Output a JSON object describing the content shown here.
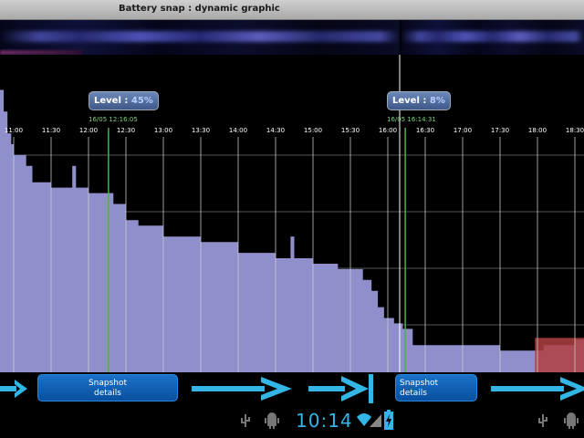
{
  "window": {
    "title": "Battery snap : dynamic graphic"
  },
  "markers": [
    {
      "label": "Level : ",
      "value": "45%",
      "timestamp": "16/05 12:16:05"
    },
    {
      "label": "Level : ",
      "value": "8%",
      "timestamp": "16/05 16:14:31"
    }
  ],
  "buttons": {
    "snapshot_line1": "Snapshot",
    "snapshot_line2": "details"
  },
  "status_bar": {
    "time": "10:14"
  },
  "colors": {
    "fill": "#8f8fcc",
    "accent": "#33b5e5",
    "button": "#0e5aa8",
    "marker_line": "#4caf50",
    "low_fill": "#b04040"
  },
  "chart_data": {
    "type": "area",
    "time_ticks": [
      "11:00",
      "11:30",
      "12:00",
      "12:30",
      "13:00",
      "13:30",
      "14:00",
      "14:30",
      "15:00",
      "15:30",
      "16:00",
      "16:30",
      "17:00",
      "17:30",
      "18:00",
      "18:30"
    ],
    "ylim": [
      0,
      100
    ],
    "series": [
      {
        "x": [
          "10:50",
          "10:52",
          "10:55",
          "10:58",
          "11:00",
          "11:10",
          "11:15",
          "11:30",
          "11:45",
          "11:47",
          "11:50",
          "12:00",
          "12:16",
          "12:20",
          "12:30",
          "12:40",
          "13:00",
          "13:30",
          "14:00",
          "14:30",
          "14:40",
          "14:42",
          "14:45",
          "15:00",
          "15:20",
          "15:30",
          "15:40",
          "15:47",
          "15:52",
          "15:57",
          "16:00",
          "16:05",
          "16:08",
          "16:12",
          "16:14"
        ],
        "values": [
          52,
          48,
          44,
          42,
          40,
          38,
          35,
          34,
          34,
          38,
          34,
          33,
          33,
          31,
          28,
          27,
          25,
          24,
          22,
          21,
          21,
          25,
          21,
          20,
          19,
          19,
          17,
          15,
          12,
          10,
          10,
          9,
          9,
          8,
          8
        ]
      },
      {
        "x": [
          "16:14",
          "16:20",
          "17:00",
          "17:30",
          "18:00",
          "18:05",
          "18:30"
        ],
        "values": [
          8,
          5,
          5,
          4,
          4,
          5,
          6
        ]
      }
    ]
  }
}
